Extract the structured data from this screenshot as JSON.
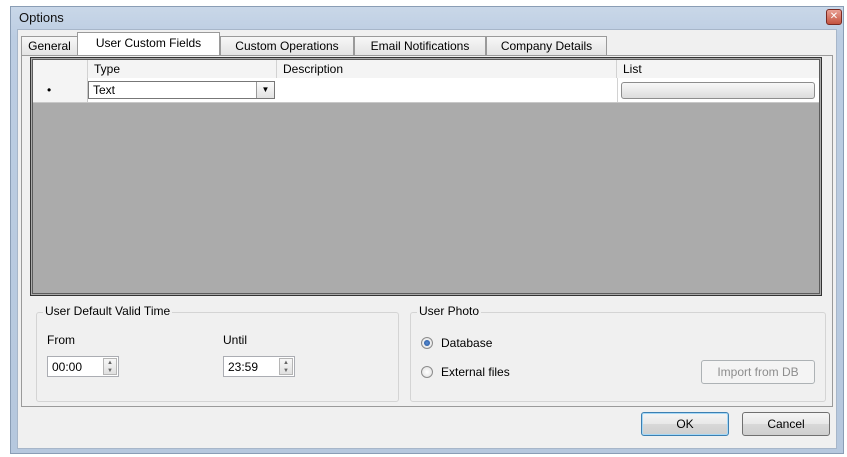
{
  "window": {
    "title": "Options",
    "close_glyph": "✕"
  },
  "tabs": [
    {
      "label": "General"
    },
    {
      "label": "User Custom Fields",
      "active": true
    },
    {
      "label": "Custom Operations"
    },
    {
      "label": "Email Notifications"
    },
    {
      "label": "Company Details"
    }
  ],
  "grid": {
    "columns": [
      {
        "label": ""
      },
      {
        "label": "Type"
      },
      {
        "label": "Description"
      },
      {
        "label": "List"
      }
    ],
    "new_row": {
      "marker": "•",
      "type_value": "Text",
      "description": "",
      "combo_arrow_glyph": "▼"
    }
  },
  "valid_time": {
    "legend": "User Default Valid Time",
    "from_label": "From",
    "from_value": "00:00",
    "until_label": "Until",
    "until_value": "23:59",
    "spin_glyph_up": "▲",
    "spin_glyph_down": "▼"
  },
  "user_photo": {
    "legend": "User Photo",
    "options": [
      {
        "label": "Database",
        "selected": true
      },
      {
        "label": "External files",
        "selected": false
      }
    ],
    "import_button": "Import from DB",
    "import_enabled": false
  },
  "buttons": {
    "ok": "OK",
    "cancel": "Cancel"
  },
  "colors": {
    "title_bar": "#bccde2",
    "dialog_bg": "#f0f0f0",
    "grid_bg": "#ababab",
    "default_button_border": "#3c7fb1",
    "close_button": "#c4533f"
  }
}
